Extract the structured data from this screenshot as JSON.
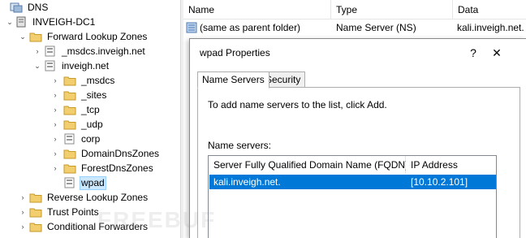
{
  "tree": {
    "root": "DNS",
    "server": "INVEIGH-DC1",
    "forward_zones": "Forward Lookup Zones",
    "msdcs_zone": "_msdcs.inveigh.net",
    "inveigh_zone": "inveigh.net",
    "children": [
      "_msdcs",
      "_sites",
      "_tcp",
      "_udp",
      "corp",
      "DomainDnsZones",
      "ForestDnsZones",
      "wpad"
    ],
    "reverse_zones": "Reverse Lookup Zones",
    "trust_points": "Trust Points",
    "conditional_forwarders": "Conditional Forwarders"
  },
  "list": {
    "columns": [
      "Name",
      "Type",
      "Data"
    ],
    "row": {
      "name": "(same as parent folder)",
      "type": "Name Server (NS)",
      "data": "kali.inveigh.net."
    }
  },
  "dialog": {
    "title": "wpad Properties",
    "help": "?",
    "close": "✕",
    "tabs": [
      "Name Servers",
      "Security"
    ],
    "instruction": "To add name servers to the list, click Add.",
    "ns_label": "Name servers:",
    "ns_columns": [
      "Server Fully Qualified Domain Name (FQDN)",
      "IP Address"
    ],
    "ns_rows": [
      {
        "fqdn": "kali.inveigh.net.",
        "ip": "[10.10.2.101]"
      }
    ]
  },
  "watermark": "FREEBUF",
  "colors": {
    "selection": "#0078d7",
    "tree_selection": "#cce8ff",
    "folder": "#e8b84a"
  }
}
